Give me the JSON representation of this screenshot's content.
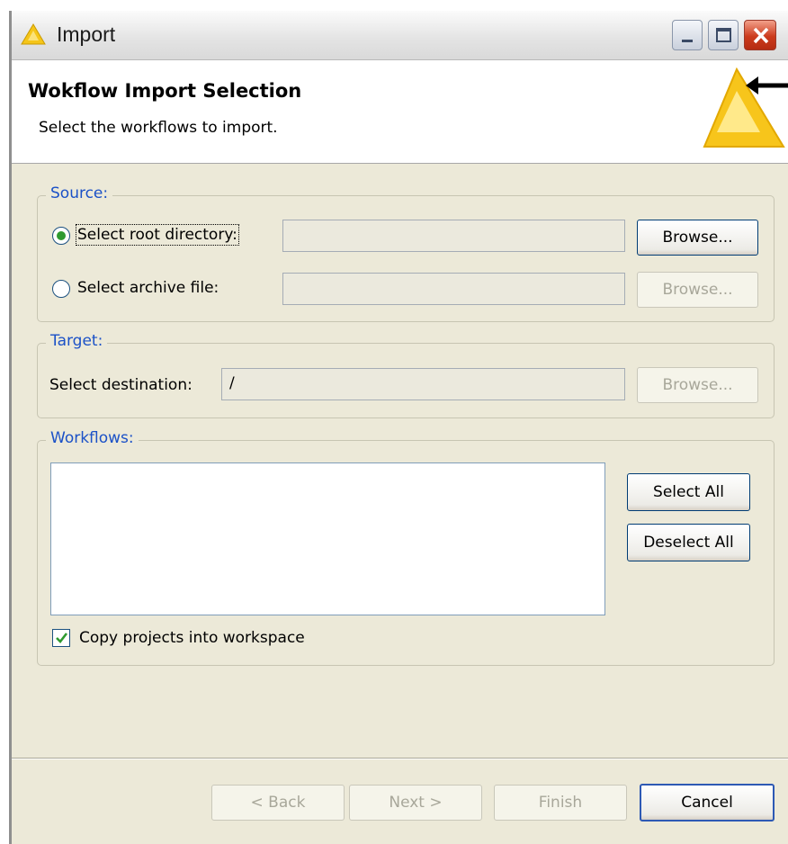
{
  "window": {
    "title": "Import",
    "controls": [
      "minimize-icon",
      "maximize-icon",
      "close-icon"
    ]
  },
  "banner": {
    "title": "Wokflow Import Selection",
    "description": "Select the workflows to import.",
    "icon": "import-wizard-icon"
  },
  "source": {
    "legend": "Source:",
    "root_dir_label": "Select root directory:",
    "root_dir_selected": true,
    "root_dir_value": "",
    "archive_label": "Select archive file:",
    "archive_selected": false,
    "archive_value": "",
    "browse_label": "Browse..."
  },
  "target": {
    "legend": "Target:",
    "dest_label": "Select destination:",
    "dest_value": "/",
    "browse_label": "Browse..."
  },
  "workflows": {
    "legend": "Workflows:",
    "items": [],
    "select_all_label": "Select All",
    "deselect_all_label": "Deselect All",
    "copy_label": "Copy projects into workspace",
    "copy_checked": true
  },
  "footer": {
    "back_label": "< Back",
    "next_label": "Next >",
    "finish_label": "Finish",
    "cancel_label": "Cancel"
  },
  "colors": {
    "dialog_bg": "#ece9d8",
    "legend_text": "#1b51c7",
    "check_mark": "#2f9a2f",
    "icon_yellow": "#f5c518"
  }
}
